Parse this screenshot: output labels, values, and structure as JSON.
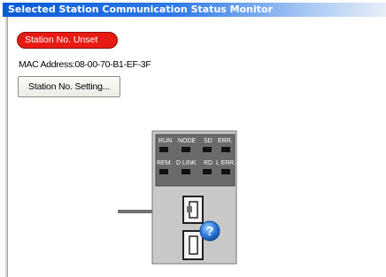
{
  "window": {
    "title": "Selected Station Communication Status Monitor"
  },
  "status": {
    "label": "Station No. Unset",
    "color": "#e81b14"
  },
  "mac": {
    "prefix": "MAC Address:",
    "value": "08-00-70-B1-EF-3F"
  },
  "buttons": {
    "station_setting": "Station No. Setting..."
  },
  "leds": {
    "row1": [
      "RUN",
      "NODE",
      "SD",
      "ERR."
    ],
    "row2": [
      "REM.",
      "D LINK",
      "RD",
      "L ERR."
    ]
  },
  "icons": {
    "help": "question-mark-icon"
  }
}
